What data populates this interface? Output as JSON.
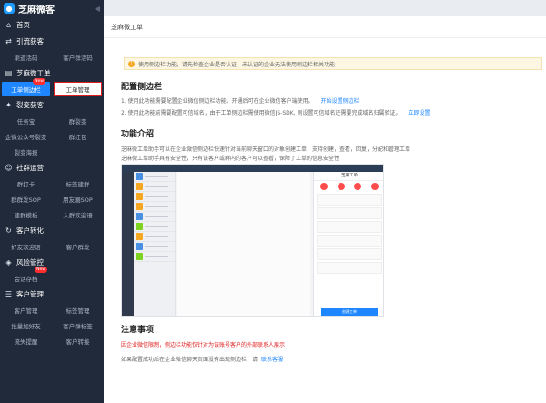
{
  "brand": {
    "name": "芝麻微客"
  },
  "sidebar": {
    "home": "首页",
    "groups": [
      {
        "title": "引流获客",
        "items": [
          "渠道活码",
          "客户群活码"
        ]
      },
      {
        "title": "芝麻微工单",
        "items": [
          "工单侧边栏",
          "工单管理"
        ],
        "badge": "New"
      },
      {
        "title": "裂变获客",
        "items": [
          "任务宝",
          "群裂变",
          "企微公众号裂变",
          "群红包",
          "裂变海报"
        ]
      },
      {
        "title": "社群运营",
        "items": [
          "群打卡",
          "标签建群",
          "群群发SOP",
          "朋友圈SOP",
          "建群模板",
          "入群欢迎语"
        ]
      },
      {
        "title": "客户转化",
        "items": [
          "好友欢迎语",
          "客户群发"
        ]
      },
      {
        "title": "风险管控",
        "items": [
          "会话存档"
        ],
        "badge": "New"
      },
      {
        "title": "客户管理",
        "items": [
          "客户管理",
          "标签管理",
          "批量加好友",
          "客户群标签",
          "流失提醒",
          "客户转接"
        ]
      }
    ]
  },
  "breadcrumb": "芝麻微工单",
  "tip": "使用侧边栏功能，请先检查企业是否认证，未认证的企业无法使用侧边栏相关功能",
  "config": {
    "title": "配置侧边栏",
    "line1": "1. 使用此功能需要配置企业微信侧边栏功能，开通后可在企业微信客户端使用。",
    "line1_link": "开始设置侧边栏",
    "line2": "2. 使用此功能前需要配置可信域名，由于工单侧边栏需使用微信JS-SDK, 则设置可信域名还需要完成域名归属验证。",
    "line2_link": "立即设置"
  },
  "intro": {
    "title": "功能介绍",
    "line1": "芝麻微工单助手可以在企业微信侧边栏快速针对当前聊天窗口的对象创建工单，支持创建，查看，回复，分配和管理工单",
    "line2": "芝麻微工单助手具有安全性，只有该客户或群内的客户可以查看，保障了工单的信息安全性"
  },
  "preview": {
    "panel_title": "芝麻工单",
    "button": "创建工单"
  },
  "notice": {
    "title": "注意事项",
    "red": "因企业微信限制，侧边栏功能仅针对为该账号客户的外部联系人展示",
    "line": "如果配置成功后在企业微信聊天页面没有出现侧边栏，请",
    "link": "联系客服"
  },
  "colors": {
    "accent": "#1e86ff",
    "sidebar": "#202a3a",
    "warning": "#f5a623",
    "danger": "#e02020"
  }
}
